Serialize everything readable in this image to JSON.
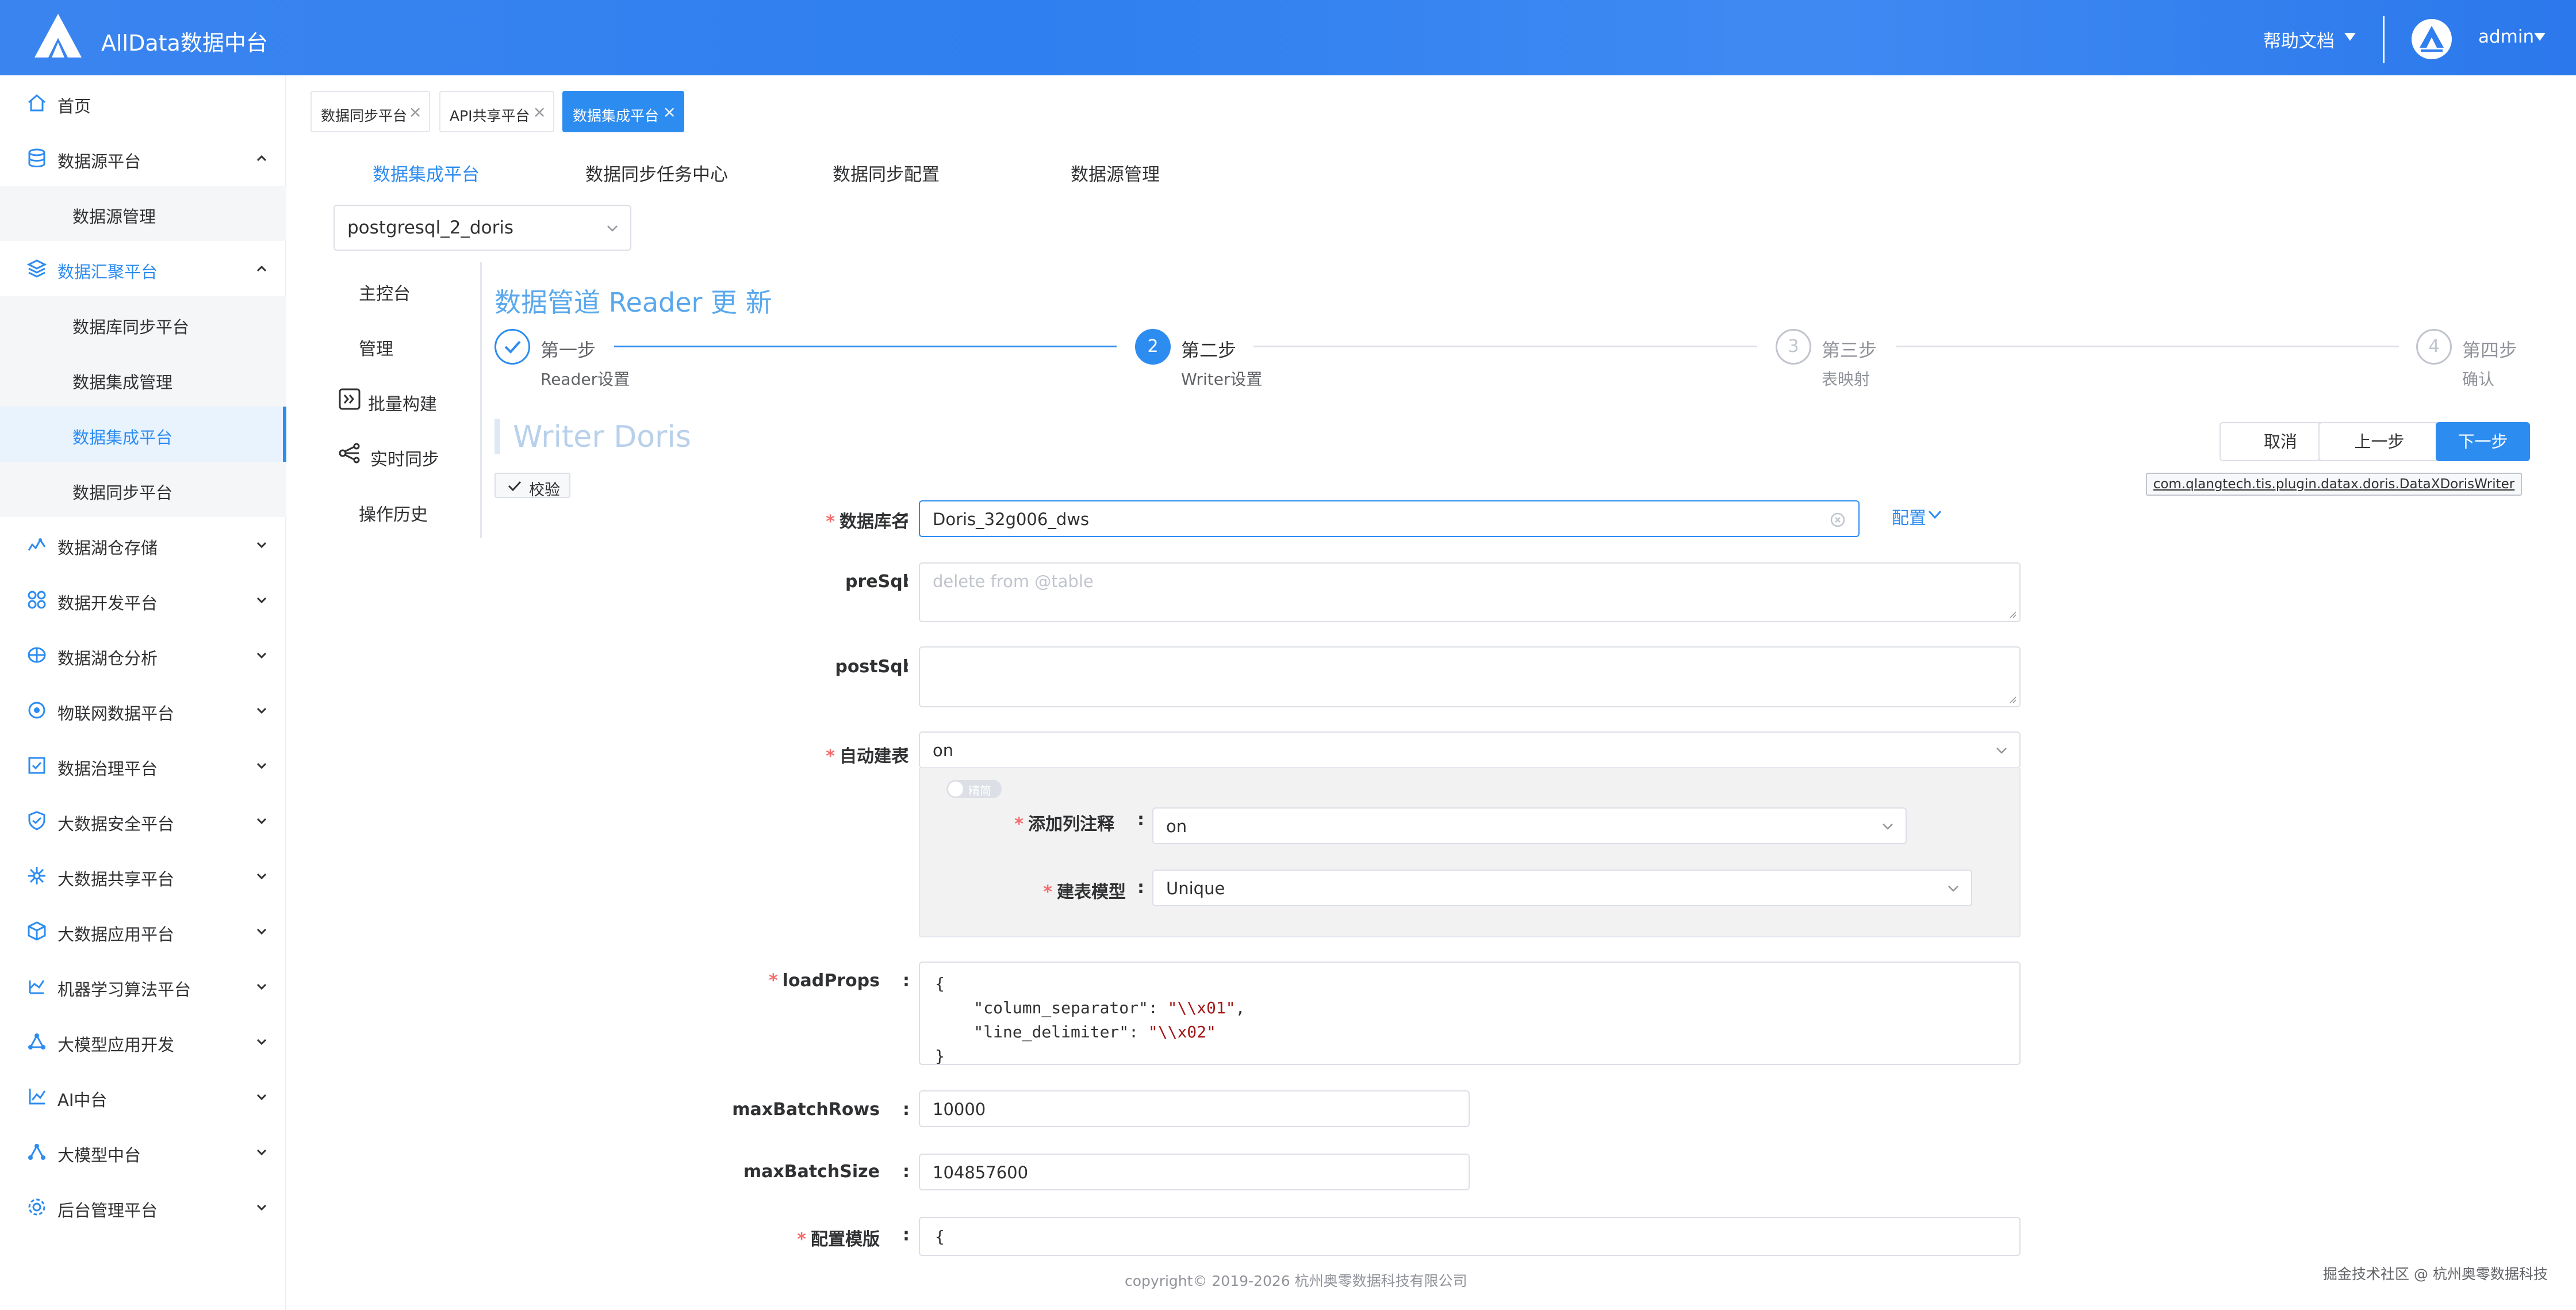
{
  "header": {
    "app_title": "AllData数据中台",
    "help_label": "帮助文档",
    "user_name": "admin"
  },
  "sidebar": {
    "items": [
      {
        "label": "首页",
        "icon": "home-icon"
      },
      {
        "label": "数据源平台",
        "icon": "database-icon",
        "expanded": true
      },
      {
        "label": "数据源管理",
        "sub": true
      },
      {
        "label": "数据汇聚平台",
        "icon": "layers-icon",
        "expanded": true
      },
      {
        "label": "数据库同步平台",
        "sub": true
      },
      {
        "label": "数据集成管理",
        "sub": true
      },
      {
        "label": "数据集成平台",
        "sub": true,
        "active": true
      },
      {
        "label": "数据同步平台",
        "sub": true
      },
      {
        "label": "数据湖仓存储",
        "icon": "storage-icon"
      },
      {
        "label": "数据开发平台",
        "icon": "grid-icon"
      },
      {
        "label": "数据湖仓分析",
        "icon": "analysis-icon"
      },
      {
        "label": "物联网数据平台",
        "icon": "iot-icon"
      },
      {
        "label": "数据治理平台",
        "icon": "governance-icon"
      },
      {
        "label": "大数据安全平台",
        "icon": "shield-icon"
      },
      {
        "label": "大数据共享平台",
        "icon": "share-icon"
      },
      {
        "label": "大数据应用平台",
        "icon": "cube-icon"
      },
      {
        "label": "机器学习算法平台",
        "icon": "ml-icon"
      },
      {
        "label": "大模型应用开发",
        "icon": "model-dev-icon"
      },
      {
        "label": "AI中台",
        "icon": "ai-icon"
      },
      {
        "label": "大模型中台",
        "icon": "model-icon"
      },
      {
        "label": "后台管理平台",
        "icon": "settings-icon"
      }
    ]
  },
  "tags": [
    {
      "label": "数据同步平台"
    },
    {
      "label": "API共享平台"
    },
    {
      "label": "数据集成平台",
      "active": true
    }
  ],
  "top_tabs": [
    {
      "label": "数据集成平台",
      "active": true
    },
    {
      "label": "数据同步任务中心"
    },
    {
      "label": "数据同步配置"
    },
    {
      "label": "数据源管理"
    }
  ],
  "pipeline_select": {
    "value": "postgresql_2_doris"
  },
  "mini_menu": [
    {
      "label": "主控台"
    },
    {
      "label": "管理"
    },
    {
      "label": "批量构建"
    },
    {
      "label": "实时同步"
    },
    {
      "label": "操作历史"
    }
  ],
  "page_title": "数据管道 Reader 更 新",
  "steps": [
    {
      "num": "1",
      "title": "第一步",
      "desc": "Reader设置",
      "status": "done"
    },
    {
      "num": "2",
      "title": "第二步",
      "desc": "Writer设置",
      "status": "current"
    },
    {
      "num": "3",
      "title": "第三步",
      "desc": "表映射",
      "status": "todo"
    },
    {
      "num": "4",
      "title": "第四步",
      "desc": "确认",
      "status": "todo"
    }
  ],
  "section_title": "Writer Doris",
  "buttons": {
    "cancel": "取消",
    "prev": "上一步",
    "next": "下一步"
  },
  "check_label": "校验",
  "class_name": "com.qlangtech.tis.plugin.datax.doris.DataXDorisWriter",
  "form": {
    "db_name": {
      "label": "数据库名",
      "value": "Doris_32g006_dws",
      "config_link": "配置"
    },
    "pre_sql": {
      "label": "preSql",
      "placeholder": "delete from @table"
    },
    "post_sql": {
      "label": "postSql",
      "value": ""
    },
    "auto_create": {
      "label": "自动建表",
      "value": "on"
    },
    "toggle_text": "精简",
    "add_col_comment": {
      "label": "添加列注释",
      "value": "on"
    },
    "table_model": {
      "label": "建表模型",
      "value": "Unique"
    },
    "load_props": {
      "label": "loadProps",
      "lines": [
        {
          "text": "{"
        },
        {
          "key": "    \"column_separator\": ",
          "val": "\"\\\\x01\"",
          "tail": ","
        },
        {
          "key": "    \"line_delimiter\": ",
          "val": "\"\\\\x02\"",
          "tail": ""
        },
        {
          "text": "}"
        }
      ]
    },
    "max_batch_rows": {
      "label": "maxBatchRows",
      "value": "10000"
    },
    "max_batch_size": {
      "label": "maxBatchSize",
      "value": "104857600"
    },
    "config_template": {
      "label": "配置模版",
      "lines": [
        "{"
      ]
    }
  },
  "colors": {
    "accent": "#2d8cf0",
    "required": "#f56c6c",
    "header": "#2f7ff0"
  },
  "footer": {
    "copyright": "copyright© 2019-2026 杭州奥零数据科技有限公司",
    "watermark": "掘金技术社区 @ 杭州奥零数据科技"
  }
}
